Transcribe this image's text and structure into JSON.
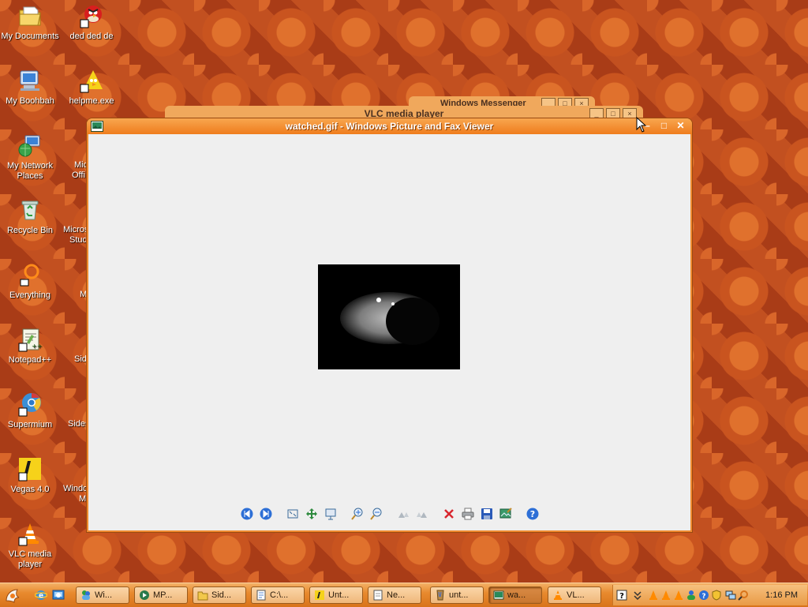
{
  "desktop": {
    "icons": [
      {
        "label": "My Documents"
      },
      {
        "label": "ded ded de"
      },
      {
        "label": "My Boohbah"
      },
      {
        "label": "helpme.exe"
      },
      {
        "label": "My Network Places"
      },
      {
        "label": "Recycle Bin"
      },
      {
        "label": "Everything"
      },
      {
        "label": "Notepad++"
      },
      {
        "label": "Supermium"
      },
      {
        "label": "Vegas 4.0"
      },
      {
        "label": "VLC media player"
      }
    ],
    "partial_labels": [
      "Mic",
      "Offi",
      "Micros",
      "Stud",
      "M",
      "Side",
      "Sides",
      "Windo",
      "M"
    ]
  },
  "background_windows": {
    "messenger_title": "Windows Messenger",
    "vlc_title": "VLC media player"
  },
  "viewer": {
    "title": "watched.gif - Windows Picture and Fax Viewer",
    "toolbar": [
      "previous-image-icon",
      "next-image-icon",
      "best-fit-icon",
      "actual-size-icon",
      "slideshow-icon",
      "zoom-in-icon",
      "zoom-out-icon",
      "rotate-clockwise-icon",
      "rotate-counterclockwise-icon",
      "delete-icon",
      "print-icon",
      "save-icon",
      "open-for-editing-icon",
      "help-icon"
    ]
  },
  "taskbar": {
    "tasks": [
      {
        "label": "Wi..."
      },
      {
        "label": "MP..."
      },
      {
        "label": "Sid..."
      },
      {
        "label": "C:\\..."
      },
      {
        "label": "Unt..."
      },
      {
        "label": "Ne..."
      },
      {
        "label": "unt..."
      },
      {
        "label": "wa..."
      },
      {
        "label": "VL..."
      }
    ],
    "clock": "1:16 PM"
  },
  "colors": {
    "accent": "#ef7d1d",
    "taskbar": "#e88a2e",
    "viewer_bg": "#efefef"
  }
}
